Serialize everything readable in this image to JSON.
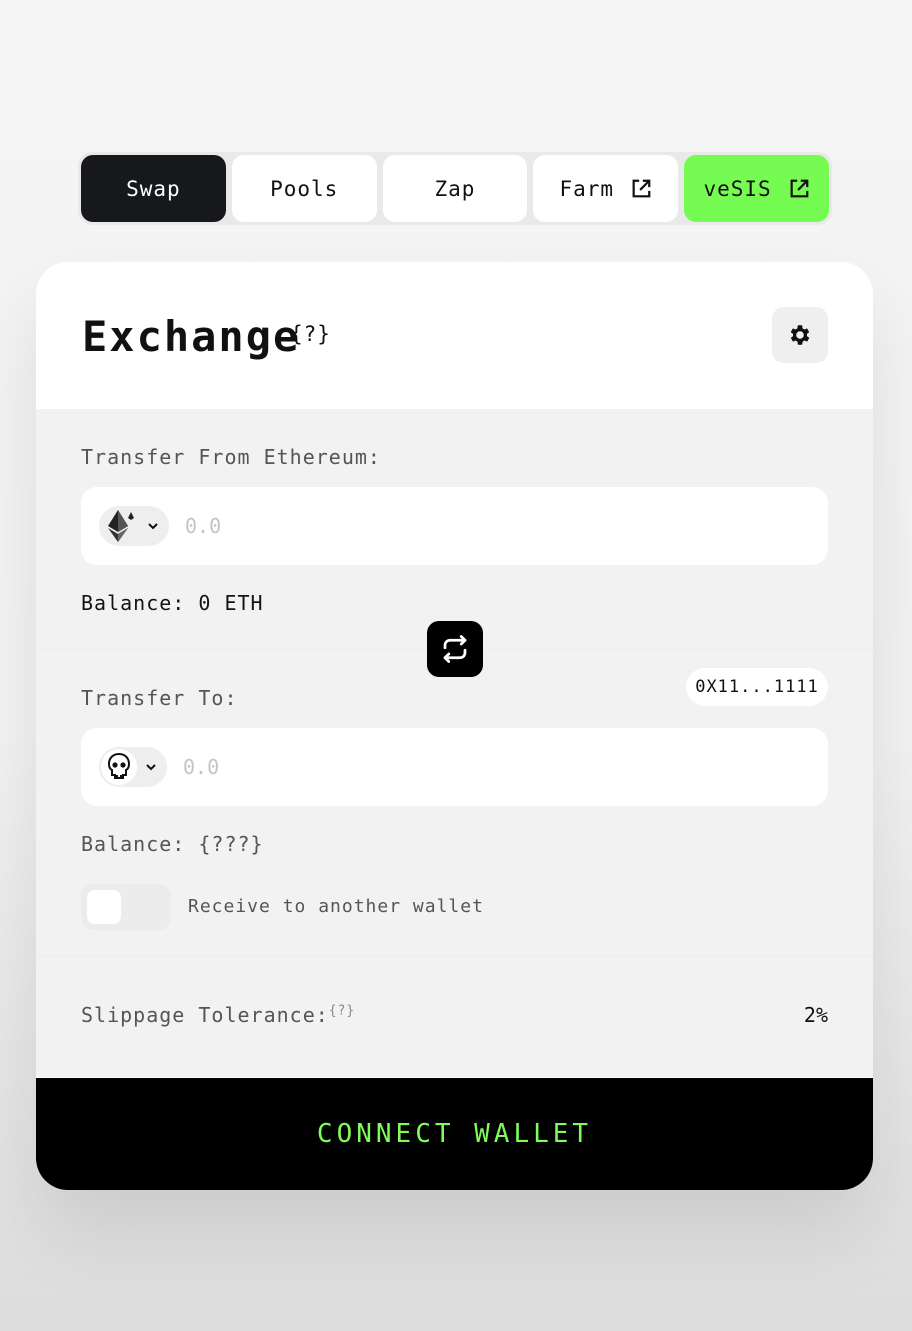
{
  "tabs": [
    {
      "label": "Swap"
    },
    {
      "label": "Pools"
    },
    {
      "label": "Zap"
    },
    {
      "label": "Farm"
    },
    {
      "label": "veSIS"
    }
  ],
  "exchange": {
    "title": "Exchange",
    "help": "{?}"
  },
  "from": {
    "label": "Transfer From Ethereum:",
    "token_icon": "ethereum-icon",
    "placeholder": "0.0",
    "balance": "Balance: 0 ETH"
  },
  "to": {
    "label": "Transfer To:",
    "address": "0X11...1111",
    "token_icon": "skull-icon",
    "placeholder": "0.0",
    "balance": "Balance: {???}",
    "toggle_label": "Receive to another wallet"
  },
  "slippage": {
    "label": "Slippage Tolerance:",
    "help": "{?}",
    "value": "2%"
  },
  "connect_label": "CONNECT WALLET",
  "colors": {
    "accent_green": "#75fb52",
    "dark": "#16181b",
    "connect_text": "#7dfc5a"
  }
}
